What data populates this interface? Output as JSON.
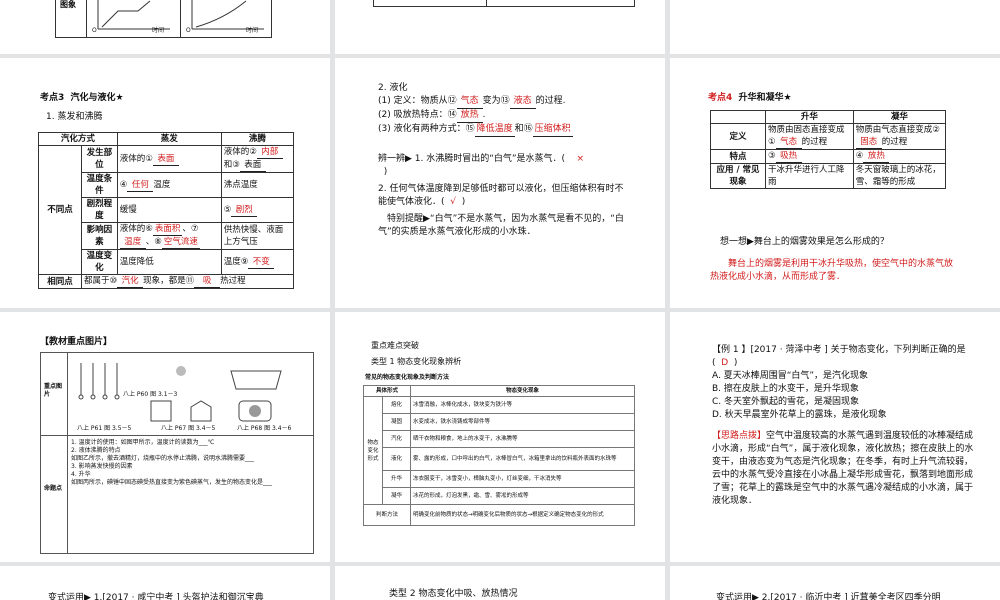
{
  "top_left": {
    "row_label": "图象",
    "axis_label_1": "时间",
    "axis_label_2": "时间",
    "origin": "O"
  },
  "s_evap": {
    "heading_num": "考点3",
    "heading_title": "汽化与液化★",
    "sub": "1. 蒸发和沸腾",
    "h_method": "汽化方式",
    "h_evap": "蒸发",
    "h_boil": "沸腾",
    "diff": "不同点",
    "same": "相同点",
    "rows": [
      {
        "label": "发生部位",
        "evap_pre": "液体的①",
        "evap_ans": "表面",
        "boil_pre": "液体的②",
        "boil_ans": "内部",
        "boil_mid": "和③",
        "boil_ans2": "表面"
      },
      {
        "label": "温度条件",
        "evap_pre": "④",
        "evap_ans": "任何",
        "evap_post": "温度",
        "boil_text": "沸点温度"
      },
      {
        "label": "剧烈程度",
        "evap_text": "缓慢",
        "boil_pre": "⑤",
        "boil_ans": "剧烈"
      },
      {
        "label": "影响因素",
        "evap_pre": "液体的⑥",
        "evap_ans": "表面积",
        "evap_mid": "、⑦",
        "evap_ans2": "温度",
        "evap_mid2": "、⑧",
        "evap_ans3": "空气流速",
        "boil_text": "供热快慢、液面上方气压"
      },
      {
        "label": "温度变化",
        "evap_text": "温度降低",
        "boil_pre": "温度⑨",
        "boil_ans": "不变"
      }
    ],
    "same_pre": "都属于⑩",
    "same_ans": "汽化",
    "same_mid": "现象，都是⑪",
    "same_ans2": "吸",
    "same_post": "热过程"
  },
  "s_liq": {
    "title": "2. 液化",
    "l1_pre": "(1) 定义：物质从⑫",
    "l1_ans1": "气态",
    "l1_mid": "变为⑬",
    "l1_ans2": "液态",
    "l1_post": "的过程.",
    "l2_pre": "(2) 吸放热特点：⑭",
    "l2_ans": "放热",
    "l2_post": ".",
    "l3_pre": "(3) 液化有两种方式：⑮",
    "l3_ans1": "降低温度",
    "l3_mid": "和⑯",
    "l3_ans2": "压缩体积",
    "judge1": "辨一辨▶ 1. 水沸腾时冒出的“白气”是水蒸气．(",
    "judge1_ans": "×",
    "judge1_close": ")",
    "judge2": "2. 任何气体温度降到足够低时都可以液化，但压缩体积有时不能使气体液化．(",
    "judge2_ans": "√",
    "judge2_close": ")",
    "tip": "特别提醒▶“白气”不是水蒸气，因为水蒸气是看不见的，“白气”的实质是水蒸气液化形成的小水珠．"
  },
  "s_sub": {
    "heading_num": "考点4",
    "heading_title": "升华和凝华★",
    "h_sub": "升华",
    "h_dep": "凝华",
    "r_def": "定义",
    "def_sub_pre": "物质由固态直接变成①",
    "def_sub_ans": "气态",
    "def_sub_post": "的过程",
    "def_dep_pre": "物质由气态直接变成②",
    "def_dep_ans": "固态",
    "def_dep_post": "的过程",
    "r_feat": "特点",
    "feat_sub_pre": "③",
    "feat_sub_ans": "吸热",
    "feat_dep_pre": "④",
    "feat_dep_ans": "放热",
    "r_app": "应用 / 常见现象",
    "app_sub": "干冰升华进行人工降雨",
    "app_dep": "冬天窗玻璃上的冰花，雪、霜等的形成",
    "think": "想一想▶舞台上的烟雾效果是怎么形成的？",
    "answer": "舞台上的烟雾是利用干冰升华吸热，使空气中的水蒸气放热液化成小水滴，从而形成了雾．"
  },
  "s_pics": {
    "title": "【教材重点图片】",
    "row1": "重点图片",
    "row2": "命题点",
    "caps": [
      "八上 P60 图 3.1－3",
      "八上 P61 图 3.5－5",
      "八上 P67 图 3.4－5",
      "八上 P68 图 3.4－6"
    ],
    "notes": [
      "1. 温度计的使用：如图甲所示，温度计的读数为___℃",
      "2. 液体沸腾的特点",
      "如图乙所示，撤去酒精灯，烧瓶中的水停止沸腾，说明水沸腾需要___",
      "3. 影响蒸发快慢的因素",
      "4. 升华",
      "如图丙所示，碘锤中固态碘受热直接变为紫色碘蒸气，发生的物态变化是___"
    ]
  },
  "s_key": {
    "title": "重点难点突破",
    "type": "类型 1  物态变化现象辨析",
    "table_title": "常见的物态变化现象及判断方法",
    "h1": "具体形式",
    "h2": "物态变化现象",
    "group": "物态变化形式",
    "rows": [
      {
        "k": "熔化",
        "v": "冰雪消融，冰棒化成水，铁块变为铁汁等"
      },
      {
        "k": "凝固",
        "v": "水变成冰，铁水浇铸成零部件等"
      },
      {
        "k": "汽化",
        "v": "晒干衣物和粮食，地上的水变干，水沸腾等"
      },
      {
        "k": "液化",
        "v": "雾、露的形成，口中呼出的白气，冰棒冒白气，冰箱里拿出的饮料瓶外表面的水珠等"
      },
      {
        "k": "升华",
        "v": "冻衣服变干，冰雪变小，樟脑丸变小，灯丝变细，干冰消失等"
      },
      {
        "k": "凝华",
        "v": "冰花的形成，灯泡发黑，霜、雪、雾凇的形成等"
      }
    ],
    "judge_k": "判断方法",
    "judge_v": "明确变化前物质的状态→明确变化后物质的状态→根据定义确定物态变化的形式"
  },
  "s_ex": {
    "q_pre": "【例 1 】[2017 · 菏泽中考 ] 关于物态变化，下列判断正确的是",
    "ans_open": "(",
    "ans": "D",
    "ans_close": ")",
    "opts": [
      "A. 夏天冰棒周围冒“白气”，是汽化现象",
      "B. 擦在皮肤上的水变干，是升华现象",
      "C. 冬天室外飘起的雪花，是凝固现象",
      "D. 秋天早晨室外花草上的露珠，是液化现象"
    ],
    "hint_label": "【思路点拨】",
    "hint": "空气中温度较高的水蒸气遇到温度较低的冰棒凝结成小水滴，形成“白气”，属于液化现象，液化放热；擦在皮肤上的水变干，由液态变为气态是汽化现象；在冬季，有时上升气流较弱，云中的水蒸气受冷直接在小冰晶上凝华形成雪花，飘落到地面形成了雪；花草上的露珠是空气中的水蒸气遇冷凝结成的小水滴，属于液化现象．"
  },
  "bottom": {
    "left": "变式运用▶ 1.[2017 · 咸宁中考 ] 头盔护法和御沉宝典",
    "mid": "类型 2    物态变化中吸、放热情况",
    "right": "变式运用▶ 2.[2017 · 临沂中考 ] 近茸美全考区四季分明"
  },
  "colors": {
    "answer_red": "#d21c1c",
    "slide_bg": "#ffffff",
    "gap_bg": "#e2e3e5"
  }
}
